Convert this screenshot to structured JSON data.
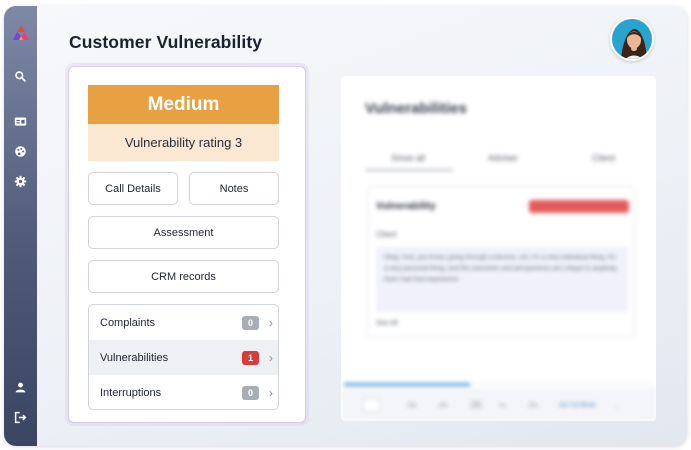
{
  "header": {
    "title": "Customer Vulnerability"
  },
  "sidebar": {
    "items": [
      {
        "icon": "search-icon"
      },
      {
        "icon": "id-card-icon"
      },
      {
        "icon": "palette-icon"
      },
      {
        "icon": "gear-icon"
      },
      {
        "icon": "user-icon"
      },
      {
        "icon": "logout-icon"
      }
    ]
  },
  "rating": {
    "level": "Medium",
    "label": "Vulnerability rating 3",
    "color": "#e7a042",
    "background": "#fbe8d3"
  },
  "buttons": {
    "call_details": "Call Details",
    "notes": "Notes",
    "assessment": "Assessment",
    "crm_records": "CRM records"
  },
  "list": [
    {
      "label": "Complaints",
      "count": "0",
      "badge_color": "#a9adb5"
    },
    {
      "label": "Vulnerabilities",
      "count": "1",
      "badge_color": "#d93a3a"
    },
    {
      "label": "Interruptions",
      "count": "0",
      "badge_color": "#a9adb5"
    }
  ],
  "right_panel": {
    "title": "Vulnerabilities",
    "tabs": [
      "Show all",
      "Adviser",
      "Client"
    ],
    "card": {
      "title": "Vulnerability",
      "client_label": "Client",
      "quote": "Okay. And, you know, going through a divorce, um, it's a very individual thing. It's a very personal thing, and the outcomes and perspectives are unique to anybody that's had that experience.",
      "see_all": "See All"
    },
    "pagination": {
      "pages": [
        "15s",
        "10s",
        "1s",
        "1s",
        "10s"
      ],
      "current": "1x",
      "link": "GO TO PEAK"
    }
  }
}
